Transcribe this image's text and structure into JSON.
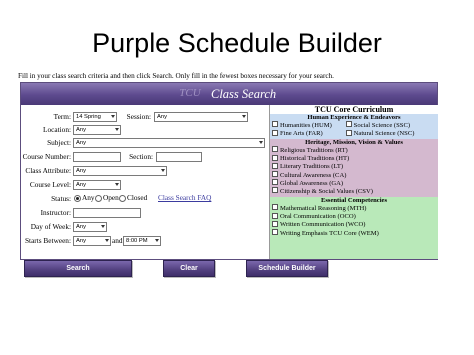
{
  "slide": {
    "title": "Purple Schedule Builder"
  },
  "instructions": "Fill in your class search criteria and then click Search. Only fill in the fewest boxes necessary for your search.",
  "banner": {
    "logo": "TCU",
    "title": "Class Search"
  },
  "form": {
    "term": {
      "label": "Term:",
      "value": "14 Spring"
    },
    "session": {
      "label": "Session:",
      "value": "Any"
    },
    "location": {
      "label": "Location:",
      "value": "Any"
    },
    "subject": {
      "label": "Subject:",
      "value": "Any"
    },
    "course_number": {
      "label": "Course Number:",
      "value": ""
    },
    "section": {
      "label": "Section:",
      "value": ""
    },
    "class_attribute": {
      "label": "Class Attribute:",
      "value": "Any"
    },
    "course_level": {
      "label": "Course Level:",
      "value": "Any"
    },
    "status": {
      "label": "Status:",
      "options": [
        "Any",
        "Open",
        "Closed"
      ],
      "selected": "Any"
    },
    "faq_link": "Class Search FAQ",
    "instructor": {
      "label": "Instructor:",
      "value": ""
    },
    "day_of_week": {
      "label": "Day of Week:",
      "value": "Any"
    },
    "starts_between": {
      "label": "Starts Between:",
      "from": "Any",
      "and_label": "and",
      "to": "8:00 PM"
    }
  },
  "core": {
    "title": "TCU Core Curriculum",
    "sections": [
      {
        "heading": "Human Experience & Endeavors",
        "color": "#c9dcf2",
        "rows": [
          [
            "Humanities (HUM)",
            "Social Science (SSC)"
          ],
          [
            "Fine Arts (FAR)",
            "Natural Science (NSC)"
          ]
        ]
      },
      {
        "heading": "Heritage, Mission, Vision & Values",
        "color": "#d4b9cf",
        "rows": [
          [
            "Religious Traditions (RT)"
          ],
          [
            "Historical Traditions (HT)"
          ],
          [
            "Literary Traditions (LT)"
          ],
          [
            "Cultural Awareness (CA)"
          ],
          [
            "Global Awareness (GA)"
          ],
          [
            "Citizenship & Social Values (CSV)"
          ]
        ]
      },
      {
        "heading": "Essential Competencies",
        "color": "#b9e9b9",
        "rows": [
          [
            "Mathematical Reasoning (MTH)"
          ],
          [
            "Oral Communication (OCO)"
          ],
          [
            "Written Communication (WCO)"
          ],
          [
            "Writing Emphasis TCU Core (WEM)"
          ]
        ]
      }
    ]
  },
  "buttons": {
    "search": "Search",
    "clear": "Clear",
    "schedule_builder": "Schedule Builder"
  },
  "colors": {
    "purple": "#5d4a8e",
    "human_bg": "#c9dcf2",
    "heritage_bg": "#d4b9cf",
    "competencies_bg": "#b9e9b9"
  }
}
